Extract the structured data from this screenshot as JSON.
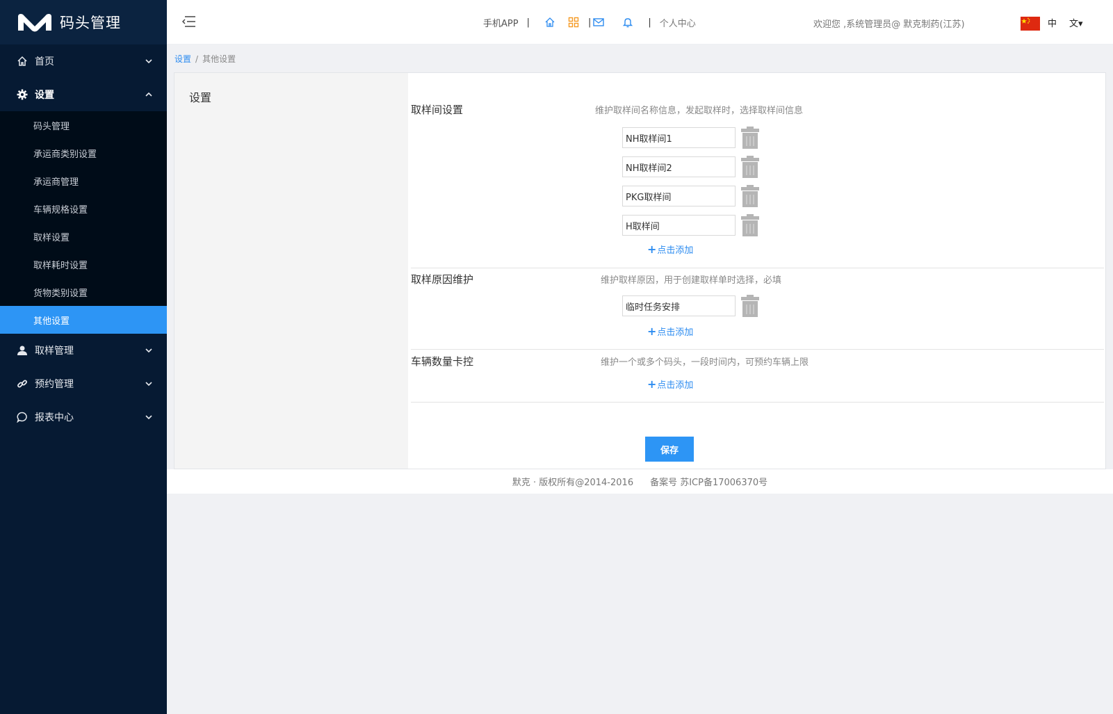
{
  "app": {
    "title": "码头管理"
  },
  "sidebar": {
    "menus": [
      {
        "label": "首页",
        "icon": "home-icon",
        "chevron": "down"
      },
      {
        "label": "设置",
        "icon": "gear-icon",
        "chevron": "up",
        "items": [
          {
            "label": "码头管理"
          },
          {
            "label": "承运商类别设置"
          },
          {
            "label": "承运商管理"
          },
          {
            "label": "车辆规格设置"
          },
          {
            "label": "取样设置"
          },
          {
            "label": "取样耗时设置"
          },
          {
            "label": "货物类别设置"
          },
          {
            "label": "其他设置",
            "active": true
          }
        ]
      },
      {
        "label": "取样管理",
        "icon": "user-icon",
        "chevron": "down"
      },
      {
        "label": "预约管理",
        "icon": "link-icon",
        "chevron": "down"
      },
      {
        "label": "报表中心",
        "icon": "chat-bubble-icon",
        "chevron": "down"
      }
    ],
    "active_color": "#2d95f5"
  },
  "header": {
    "mobile_app": "手机APP",
    "personal_center": "个人中心",
    "welcome": "欢迎您 ,系统管理员@ 默克制药(江苏)",
    "lang_current": "中",
    "lang_select": "文▾",
    "icons": [
      "menu-fold-icon",
      "home-icon",
      "grid-icon",
      "mail-icon",
      "bell-icon",
      "china-flag-icon"
    ]
  },
  "breadcrumb": {
    "root": "设置",
    "sep": "/",
    "current": "其他设置"
  },
  "panel": {
    "left_title": "设置",
    "sections": {
      "sampling_room": {
        "title": "取样间设置",
        "desc": "维护取样间名称信息，发起取样时，选择取样间信息",
        "values": [
          "NH取样间1",
          "NH取样间2",
          "PKG取样间",
          "H取样间"
        ],
        "add_label": "点击添加"
      },
      "sampling_reason": {
        "title": "取样原因维护",
        "desc": "维护取样原因，用于创建取样单时选择，必填",
        "values": [
          "临时任务安排"
        ],
        "add_label": "点击添加"
      },
      "vehicle_limit": {
        "title": "车辆数量卡控",
        "desc": "维护一个或多个码头，一段时间内，可预约车辆上限",
        "add_label": "点击添加"
      }
    },
    "save_label": "保存"
  },
  "footer": {
    "copyright": "默克 · 版权所有@2014-2016",
    "icp": "备案号 苏ICP备17006370号"
  }
}
